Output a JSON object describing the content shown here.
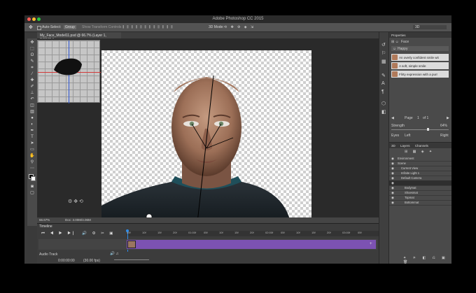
{
  "app": {
    "title": "Adobe Photoshop CC 2015"
  },
  "options_bar": {
    "auto_select_label": "Auto-Select:",
    "auto_select_value": "Group",
    "show_transform": "Show Transform Controls",
    "mode_3d": "3D Mode:",
    "workspace": "3D"
  },
  "document": {
    "tab_label": "My_Face_Model11.psd @ 66.7% (Layer 1, RGB/8) *"
  },
  "status": {
    "zoom": "66.67%",
    "doc": "Doc: 3.00M/4.06M"
  },
  "timeline": {
    "title": "Timeline",
    "audio_track": "Audio Track",
    "timecode": "0:00:00:00",
    "fps": "(30.00 fps)",
    "ruler": [
      "05f",
      "10f",
      "15f",
      "20f",
      "01:00f",
      "05f",
      "10f",
      "15f",
      "20f",
      "02:00f",
      "05f",
      "10f",
      "15f",
      "20f",
      "03:00f",
      "05f"
    ]
  },
  "properties": {
    "title": "Properties",
    "tab": "Face",
    "preset_dropdown": "Happy",
    "presets": [
      "An overly confident smile wit",
      "A soft, simple smile",
      "Flirty expression with a purr"
    ],
    "page_label": "Page",
    "page_value": "1",
    "page_of": "of 1",
    "strength_label": "Strength",
    "strength_value": "64%",
    "strength_fraction": 0.64,
    "eyes_label": "Eyes",
    "eyes_left": "Left",
    "eyes_right": "Right"
  },
  "layers_panel": {
    "tabs": [
      "3D",
      "Layers",
      "Channels"
    ],
    "items": [
      {
        "name": "Environment",
        "indent": 0,
        "sel": false
      },
      {
        "name": "Scene",
        "indent": 0,
        "sel": false
      },
      {
        "name": "Current View",
        "indent": 1,
        "sel": false
      },
      {
        "name": "Infinite Light 1",
        "indent": 1,
        "sel": false
      },
      {
        "name": "Default Camera",
        "indent": 1,
        "sel": false
      },
      {
        "name": "",
        "indent": 1,
        "sel": true
      },
      {
        "name": "Bodymat",
        "indent": 2,
        "sel": false
      },
      {
        "name": "Shoesmat",
        "indent": 2,
        "sel": false
      },
      {
        "name": "Topmat",
        "indent": 2,
        "sel": false
      },
      {
        "name": "Bottommat",
        "indent": 2,
        "sel": false
      }
    ]
  },
  "colors": {
    "purple_clip": "#7c52b2",
    "accent_blue": "#2d8ceb"
  }
}
